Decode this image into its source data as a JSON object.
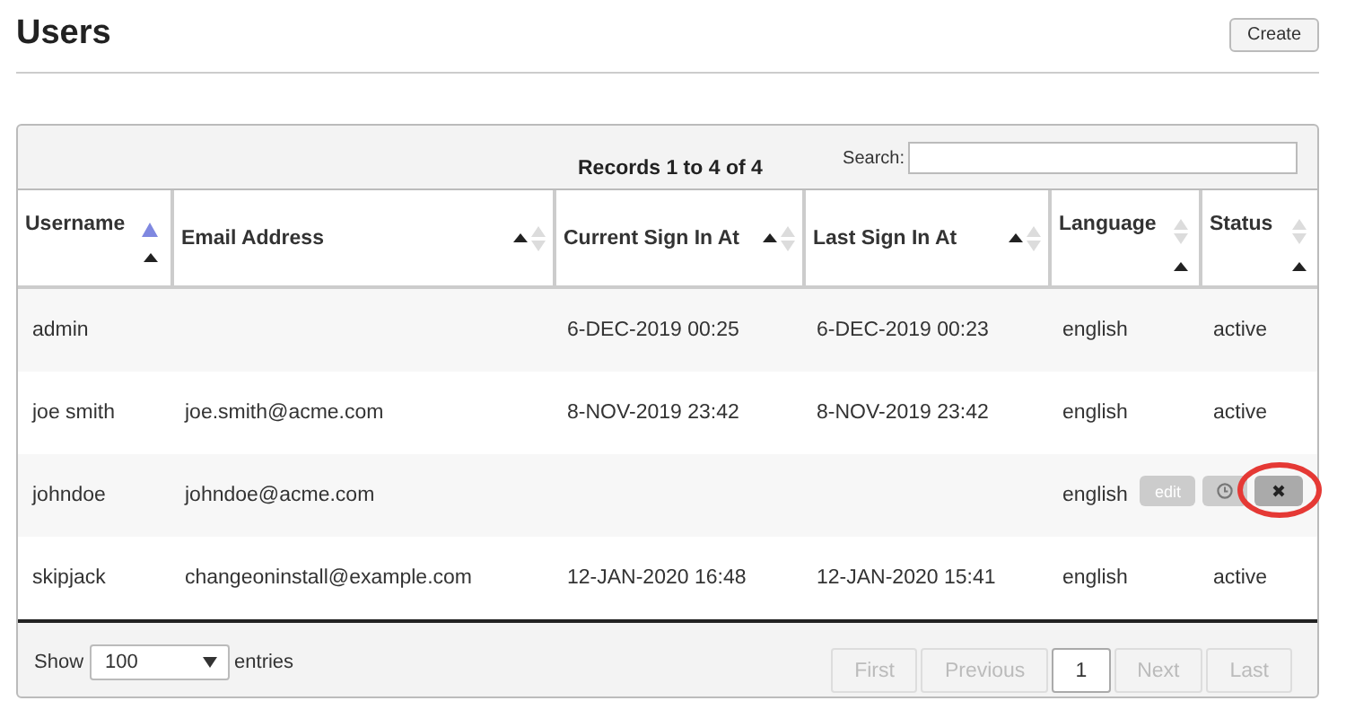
{
  "page": {
    "title": "Users",
    "create_button": "Create"
  },
  "table": {
    "info": "Records 1 to 4 of 4",
    "search": {
      "label": "Search:"
    },
    "columns": [
      {
        "label": "Username",
        "sorted": true
      },
      {
        "label": "Email Address",
        "sorted": false
      },
      {
        "label": "Current Sign In At",
        "sorted": false
      },
      {
        "label": "Last Sign In At",
        "sorted": false
      },
      {
        "label": "Language",
        "sorted": false
      },
      {
        "label": "Status",
        "sorted": false
      }
    ],
    "rows": [
      {
        "cells": [
          "admin",
          "",
          "6-DEC-2019 00:25",
          "6-DEC-2019 00:23",
          "english",
          "active"
        ]
      },
      {
        "cells": [
          "joe smith",
          "joe.smith@acme.com",
          "8-NOV-2019 23:42",
          "8-NOV-2019 23:42",
          "english",
          "active"
        ]
      },
      {
        "cells": [
          "johndoe",
          "johndoe@acme.com",
          "",
          "",
          "english",
          ""
        ],
        "actions": [
          {
            "kind": "text",
            "label": "edit",
            "circled": false
          },
          {
            "kind": "clock",
            "circled": false
          },
          {
            "kind": "delete",
            "circled": true
          }
        ]
      },
      {
        "cells": [
          "skipjack",
          "changeoninstall@example.com",
          "12-JAN-2020 16:48",
          "12-JAN-2020 15:41",
          "english",
          "active"
        ]
      }
    ]
  },
  "footer": {
    "show_label": "Show",
    "page_size": "100",
    "entries_label": "entries",
    "pagination": [
      {
        "label": "First",
        "selected": false,
        "disabled": true
      },
      {
        "label": "Previous",
        "selected": false,
        "disabled": true
      },
      {
        "label": "1",
        "selected": true,
        "disabled": false
      },
      {
        "label": "Next",
        "selected": false,
        "disabled": true
      },
      {
        "label": "Last",
        "selected": false,
        "disabled": true
      }
    ]
  }
}
